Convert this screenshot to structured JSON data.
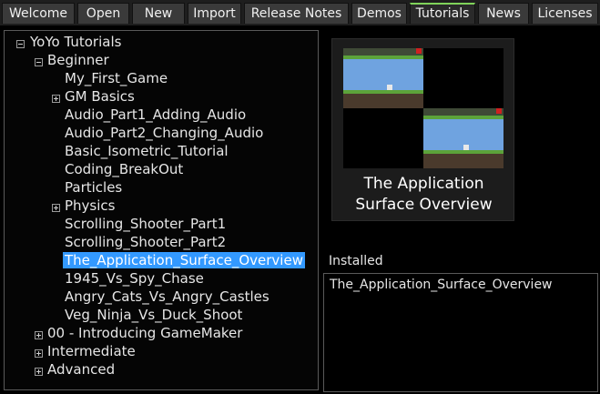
{
  "tabs": [
    {
      "label": "Welcome"
    },
    {
      "label": "Open"
    },
    {
      "label": "New"
    },
    {
      "label": "Import"
    },
    {
      "label": "Release Notes"
    },
    {
      "label": "Demos"
    },
    {
      "label": "Tutorials",
      "active": true
    },
    {
      "label": "News"
    },
    {
      "label": "Licenses"
    }
  ],
  "tree": {
    "root": "YoYo Tutorials",
    "beginner": "Beginner",
    "items": [
      "My_First_Game",
      "GM Basics",
      "Audio_Part1_Adding_Audio",
      "Audio_Part2_Changing_Audio",
      "Basic_Isometric_Tutorial",
      "Coding_BreakOut",
      "Particles",
      "Physics",
      "Scrolling_Shooter_Part1",
      "Scrolling_Shooter_Part2",
      "The_Application_Surface_Overview",
      "1945_Vs_Spy_Chase",
      "Angry_Cats_Vs_Angry_Castles",
      "Veg_Ninja_Vs_Duck_Shoot"
    ],
    "groups": [
      "00 - Introducing GameMaker",
      "Intermediate",
      "Advanced"
    ]
  },
  "preview": {
    "title": "The Application Surface Overview"
  },
  "installed": {
    "label": "Installed",
    "items": [
      "The_Application_Surface_Overview"
    ]
  },
  "colors": {
    "selection": "#3399ff",
    "active_tab_accent": "#7fd35a"
  }
}
